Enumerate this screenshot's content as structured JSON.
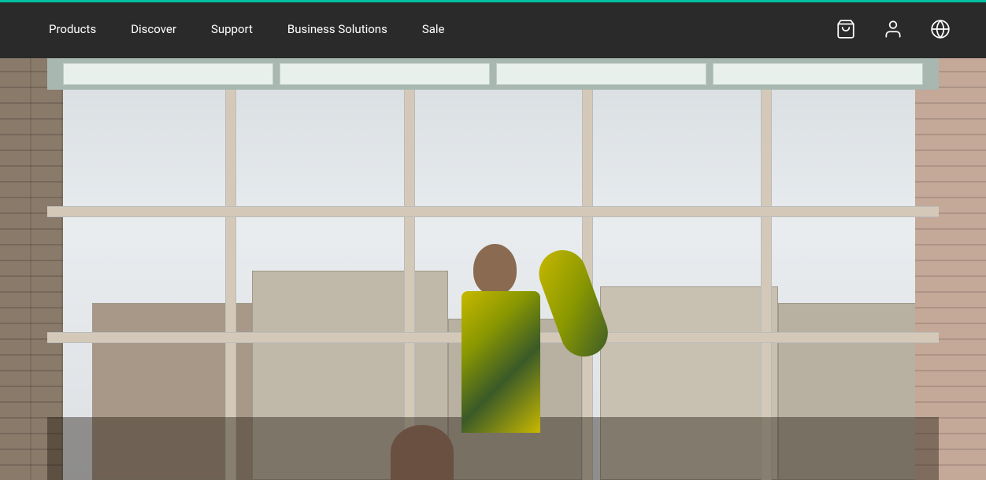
{
  "navbar": {
    "background": "#2a2a2a",
    "accent_color": "#00c0a0",
    "nav_items": [
      {
        "label": "Products",
        "id": "products"
      },
      {
        "label": "Discover",
        "id": "discover"
      },
      {
        "label": "Support",
        "id": "support"
      },
      {
        "label": "Business Solutions",
        "id": "business-solutions"
      },
      {
        "label": "Sale",
        "id": "sale"
      }
    ],
    "icons": [
      {
        "name": "cart-icon",
        "symbol": "cart"
      },
      {
        "name": "user-icon",
        "symbol": "user"
      },
      {
        "name": "globe-icon",
        "symbol": "globe"
      }
    ]
  },
  "hero": {
    "alt": "Person in yellow and blue camouflage top near large industrial windows"
  }
}
